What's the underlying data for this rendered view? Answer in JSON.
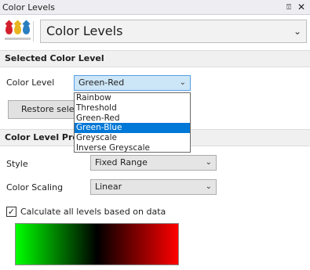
{
  "window": {
    "title": "Color Levels",
    "pin_glyph": "⍔",
    "close_glyph": "✕"
  },
  "header": {
    "icon": "color-drops-icon",
    "selected": "Color Levels"
  },
  "selected_section": {
    "title": "Selected Color Level",
    "color_level_label": "Color Level",
    "color_level_value": "Green-Red",
    "restore_label": "Restore selected",
    "options": [
      "Rainbow",
      "Threshold",
      "Green-Red",
      "Green-Blue",
      "Greyscale",
      "Inverse Greyscale"
    ],
    "highlighted_option": "Green-Blue"
  },
  "properties_section": {
    "title": "Color Level Properties",
    "style_label": "Style",
    "style_value": "Fixed Range",
    "scaling_label": "Color Scaling",
    "scaling_value": "Linear",
    "calc_label": "Calculate all levels based on data",
    "calc_checked": true
  },
  "gradient": {
    "stops": [
      "#00ff00",
      "#000000",
      "#ff0000"
    ]
  },
  "colors": {
    "highlight": "#0078d7",
    "active_combo": "#cde6f7"
  }
}
